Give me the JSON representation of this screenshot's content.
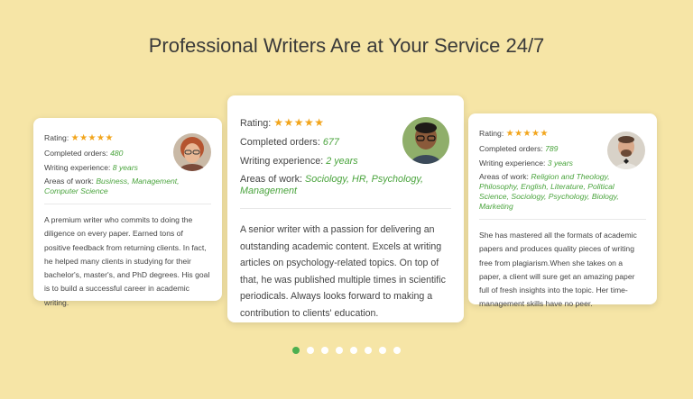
{
  "page": {
    "title": "Professional Writers Are at Your Service 24/7"
  },
  "colors": {
    "background": "#f6e5a6",
    "accent": "#4aa43d",
    "star": "#f2a51c",
    "dot_active": "#4caf50"
  },
  "labels": {
    "rating": "Rating:",
    "completed": "Completed orders:",
    "experience": "Writing experience:",
    "areas": "Areas of work:"
  },
  "writers": [
    {
      "rating": 5,
      "stars": "★★★★★",
      "completed_orders": "480",
      "experience": "8 years",
      "areas": "Business, Management, Computer Science",
      "description": "A premium writer who commits to doing the diligence on every paper. Earned tons of positive feedback from returning clients. In fact, he helped many clients in studying for their bachelor's, master's, and PhD degrees. His goal is to build a successful career in academic writing."
    },
    {
      "rating": 5,
      "stars": "★★★★★",
      "completed_orders": "677",
      "experience": "2 years",
      "areas": "Sociology, HR, Psychology, Management",
      "description": "A senior writer with a passion for delivering an outstanding academic content. Excels at writing articles on psychology-related topics. On top of that, he was published multiple times in scientific periodicals. Always looks forward to making a contribution to clients' education."
    },
    {
      "rating": 5,
      "stars": "★★★★★",
      "completed_orders": "789",
      "experience": "3 years",
      "areas": "Religion and Theology, Philosophy, English, Literature, Political Science, Sociology, Psychology, Biology, Marketing",
      "description": "She has mastered all the formats of academic papers and produces quality pieces of writing free from plagiarism.When she takes on a paper, a client will sure get an amazing paper full of fresh insights into the topic. Her time-management skills have no peer."
    }
  ],
  "carousel": {
    "total_pages": 8,
    "active_page": 1
  }
}
